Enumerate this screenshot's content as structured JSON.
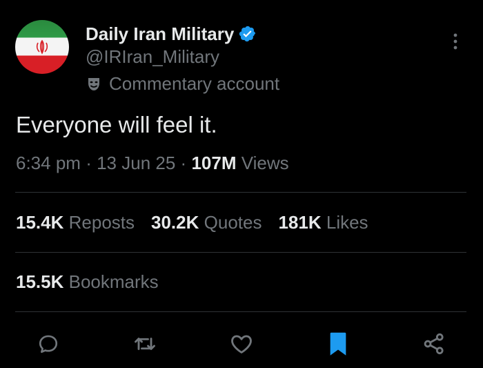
{
  "author": {
    "display_name": "Daily Iran Military",
    "handle": "@IRIran_Military",
    "account_label": "Commentary account",
    "verified": true
  },
  "tweet": {
    "text": "Everyone will feel it.",
    "time": "6:34 pm",
    "separator": "·",
    "date": "13 Jun 25",
    "views_count": "107M",
    "views_label": "Views"
  },
  "stats": {
    "reposts_count": "15.4K",
    "reposts_label": "Reposts",
    "quotes_count": "30.2K",
    "quotes_label": "Quotes",
    "likes_count": "181K",
    "likes_label": "Likes",
    "bookmarks_count": "15.5K",
    "bookmarks_label": "Bookmarks"
  },
  "icons": {
    "verified": "verified-badge-icon",
    "label": "theater-mask-icon",
    "more": "more-vertical-icon",
    "reply": "comment-icon",
    "repost": "repost-icon",
    "like": "heart-icon",
    "bookmark": "bookmark-filled-icon",
    "share": "share-icon"
  },
  "colors": {
    "background": "#000000",
    "primary_text": "#e7e9ea",
    "secondary_text": "#71767b",
    "divider": "#2f3336",
    "accent": "#1d9bf0",
    "icon": "#71767b"
  }
}
